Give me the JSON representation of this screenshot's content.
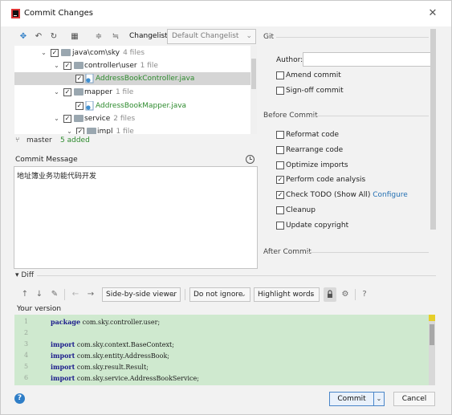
{
  "window": {
    "title": "Commit Changes"
  },
  "toolbar": {
    "changelist_label": "Changelist:",
    "changelist_value": "Default Changelist"
  },
  "tree": {
    "rows": [
      {
        "label": "java\\com\\sky",
        "count": "4 files"
      },
      {
        "label": "controller\\user",
        "count": "1 file"
      },
      {
        "label": "AddressBookController.java",
        "count": ""
      },
      {
        "label": "mapper",
        "count": "1 file"
      },
      {
        "label": "AddressBookMapper.java",
        "count": ""
      },
      {
        "label": "service",
        "count": "2 files"
      },
      {
        "label": "impl",
        "count": "1 file"
      }
    ]
  },
  "status": {
    "branch": "master",
    "added": "5 added"
  },
  "commit_message": {
    "label": "Commit Message",
    "text": "地址簿业务功能代码开发"
  },
  "git": {
    "header": "Git",
    "author_label": "Author:",
    "author_value": "",
    "amend": {
      "label": "Amend commit",
      "checked": false
    },
    "signoff": {
      "label": "Sign-off commit",
      "checked": false
    }
  },
  "before_commit": {
    "header": "Before Commit",
    "options": [
      {
        "label": "Reformat code",
        "checked": false
      },
      {
        "label": "Rearrange code",
        "checked": false
      },
      {
        "label": "Optimize imports",
        "checked": false
      },
      {
        "label": "Perform code analysis",
        "checked": true
      },
      {
        "label": "Check TODO (Show All)",
        "checked": true,
        "link": "Configure"
      },
      {
        "label": "Cleanup",
        "checked": false
      },
      {
        "label": "Update copyright",
        "checked": false
      }
    ]
  },
  "after_commit": {
    "header": "After Commit"
  },
  "diff": {
    "header": "Diff",
    "viewer": "Side-by-side viewer",
    "whitespace": "Do not ignore",
    "highlight": "Highlight words",
    "help": "?",
    "your_version": "Your version",
    "lines": [
      {
        "num": "1",
        "kw": "package",
        "rest": " com.sky.controller.user;"
      },
      {
        "num": "2",
        "kw": "",
        "rest": ""
      },
      {
        "num": "3",
        "kw": "import",
        "rest": " com.sky.context.BaseContext;"
      },
      {
        "num": "4",
        "kw": "import",
        "rest": " com.sky.entity.AddressBook;"
      },
      {
        "num": "5",
        "kw": "import",
        "rest": " com.sky.result.Result;"
      },
      {
        "num": "6",
        "kw": "import",
        "rest": " com.sky.service.AddressBookService;"
      }
    ]
  },
  "footer": {
    "commit_label": "Commit",
    "cancel_label": "Cancel",
    "help": "?"
  },
  "colors": {
    "accent": "#2470b3",
    "added": "#2e8b2e",
    "diff_bg": "#cfe9cf"
  }
}
